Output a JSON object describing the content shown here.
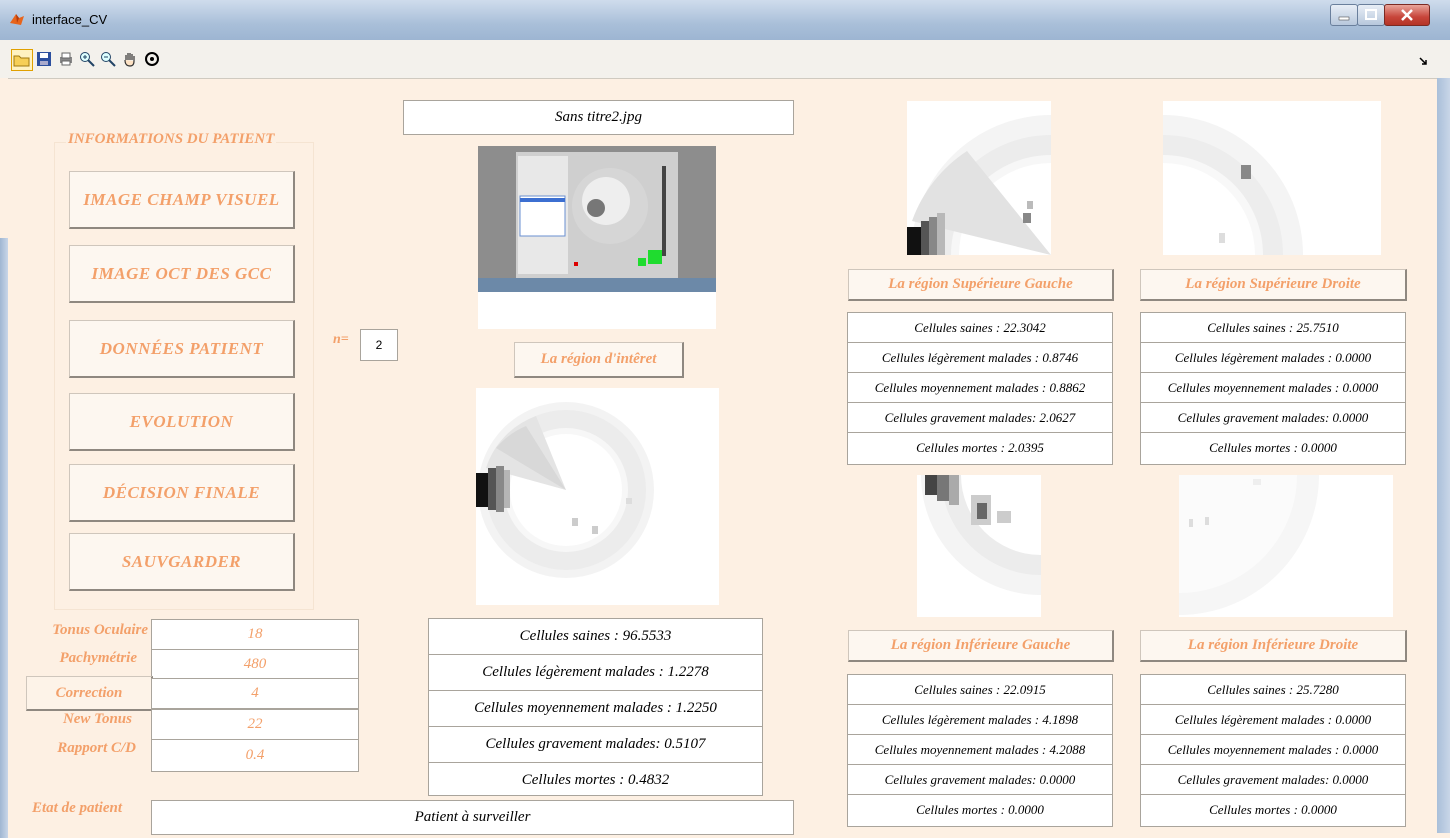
{
  "window": {
    "title": "interface_CV"
  },
  "toolbar": {
    "icons": [
      "open-folder-icon",
      "save-icon",
      "print-icon",
      "zoom-in-icon",
      "zoom-out-icon",
      "pan-hand-icon",
      "rotate-3d-icon"
    ]
  },
  "panel": {
    "title": "INFORMATIONS DU PATIENT",
    "buttons": [
      "IMAGE CHAMP VISUEL",
      "IMAGE OCT DES GCC",
      "DONNÉES PATIENT",
      "EVOLUTION",
      "DÉCISION FINALE",
      "SAUVGARDER"
    ]
  },
  "n": {
    "label": "n=",
    "value": "2"
  },
  "file_name": "Sans titre2.jpg",
  "roi_button": "La région d'intêret",
  "params": [
    {
      "label": "Tonus Oculaire",
      "value": "18"
    },
    {
      "label": "Pachymétrie",
      "value": "480"
    },
    {
      "label": "Correction",
      "value": "4"
    },
    {
      "label": "New Tonus",
      "value": "22"
    },
    {
      "label": "Rapport C/D",
      "value": "0.4"
    }
  ],
  "main_stats": [
    "Cellules saines : 96.5533",
    "Cellules légèrement malades : 1.2278",
    "Cellules moyennement malades : 1.2250",
    "Cellules gravement malades: 0.5107",
    "Cellules mortes : 0.4832"
  ],
  "regions": {
    "sup_gauche": {
      "title": "La région Supérieure Gauche",
      "stats": [
        "Cellules saines : 22.3042",
        "Cellules légèrement malades : 0.8746",
        "Cellules moyennement malades : 0.8862",
        "Cellules gravement malades: 2.0627",
        "Cellules mortes : 2.0395"
      ]
    },
    "sup_droite": {
      "title": "La région Supérieure Droite",
      "stats": [
        "Cellules saines : 25.7510",
        "Cellules légèrement malades : 0.0000",
        "Cellules moyennement malades : 0.0000",
        "Cellules gravement malades: 0.0000",
        "Cellules mortes : 0.0000"
      ]
    },
    "inf_gauche": {
      "title": "La région Inférieure Gauche",
      "stats": [
        "Cellules saines : 22.0915",
        "Cellules légèrement malades : 4.1898",
        "Cellules moyennement malades : 4.2088",
        "Cellules gravement malades: 0.0000",
        "Cellules mortes : 0.0000"
      ]
    },
    "inf_droite": {
      "title": "La région Inférieure Droite",
      "stats": [
        "Cellules saines : 25.7280",
        "Cellules légèrement malades : 0.0000",
        "Cellules moyennement malades : 0.0000",
        "Cellules gravement malades: 0.0000",
        "Cellules mortes : 0.0000"
      ]
    }
  },
  "etat": {
    "label": "Etat de patient",
    "value": "Patient à surveiller"
  },
  "colors": {
    "accent": "#f3a06a",
    "background": "#fdf0e3"
  }
}
